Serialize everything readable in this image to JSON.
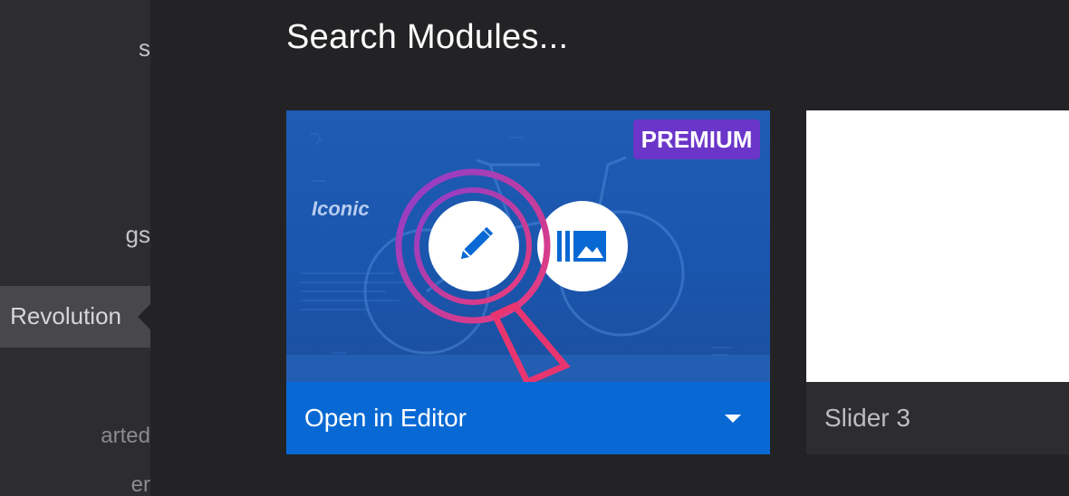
{
  "sidebar": {
    "items": [
      {
        "label": "s"
      },
      {
        "label": "gs"
      },
      {
        "label": "Revolution",
        "active": true
      },
      {
        "label": "arted"
      },
      {
        "label": "er"
      }
    ]
  },
  "main": {
    "title": "Search Modules...",
    "cards": [
      {
        "badge": "PREMIUM",
        "thumbnail_text": {
          "brand": "Iconic"
        },
        "footer_label": "Open in Editor",
        "footer_icon": "chevron-down-icon",
        "actions": [
          {
            "icon": "pencil-icon"
          },
          {
            "icon": "media-library-icon"
          }
        ],
        "overlay_icon": "magnifier-icon"
      },
      {
        "footer_label": "Slider 3"
      }
    ]
  },
  "colors": {
    "background": "#232325",
    "sidebar": "#2d2d2f",
    "accent_blue": "#0969d4",
    "premium_badge": "#6b35c9",
    "magnifier_gradient_start": "#8a3fcf",
    "magnifier_gradient_end": "#ee3b78"
  }
}
